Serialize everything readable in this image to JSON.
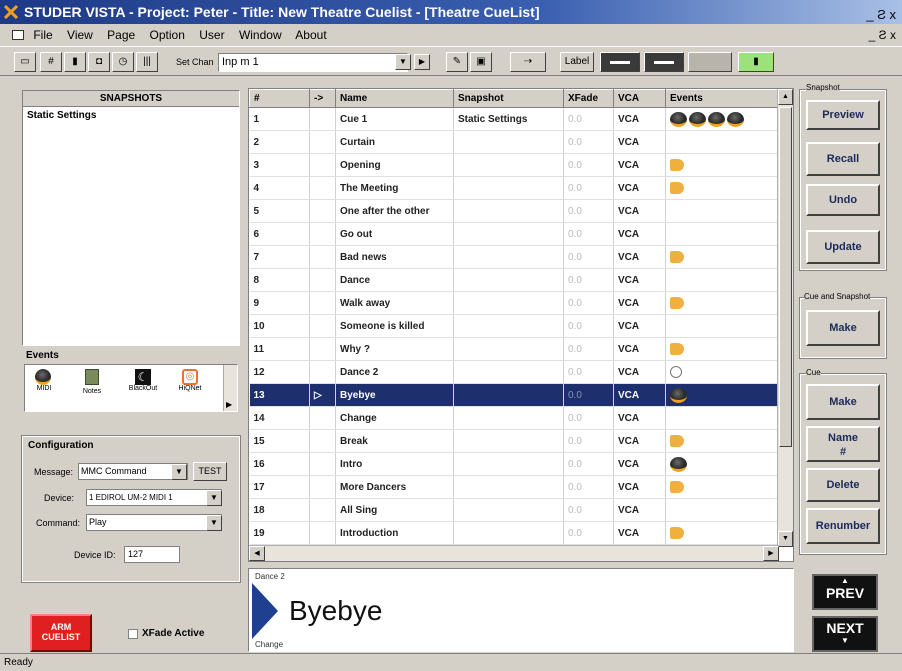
{
  "window": {
    "title": "STUDER VISTA - Project: Peter - Title: New Theatre Cuelist - [Theatre CueList]",
    "controls": "_ Ƨ x",
    "mdi_controls": "_ Ƨ x"
  },
  "menu": [
    "File",
    "View",
    "Page",
    "Option",
    "User",
    "Window",
    "About"
  ],
  "toolbar": {
    "set_chan_label": "Set Chan",
    "set_chan_value": "Inp m 1",
    "label_button": "Label",
    "status_colors": {
      "green": "#9be27a",
      "dark": "#3a3a3a"
    }
  },
  "snapshots": {
    "header": "SNAPSHOTS",
    "items": [
      "Static Settings"
    ]
  },
  "events_panel": {
    "header": "Events",
    "items": [
      {
        "label": "MIDI",
        "icon": "midi-icon"
      },
      {
        "label": "Notes",
        "icon": "notes-icon"
      },
      {
        "label": "BlackOut",
        "icon": "blackout-icon"
      },
      {
        "label": "HiQNet",
        "icon": "hiqnet-icon"
      }
    ]
  },
  "configuration": {
    "header": "Configuration",
    "message_label": "Message:",
    "message_value": "MMC Command",
    "test_button": "TEST",
    "device_label": "Device:",
    "device_value": "1 EDIROL UM-2 MIDI 1",
    "command_label": "Command:",
    "command_value": "Play",
    "device_id_label": "Device ID:",
    "device_id_value": "127"
  },
  "arm_cuelist": {
    "label": "ARM\nCUELIST",
    "color": "#e02020"
  },
  "xfade_active": {
    "label": "XFade Active",
    "checked": false
  },
  "cuelist": {
    "columns": [
      "#",
      "->",
      "Name",
      "Snapshot",
      "XFade",
      "VCA",
      "Events"
    ],
    "rows": [
      {
        "num": "1",
        "name": "Cue 1",
        "snapshot": "Static Settings",
        "xfade": "0.0",
        "vca": "VCA",
        "events": [
          "midi",
          "midi",
          "midi",
          "midi"
        ]
      },
      {
        "num": "2",
        "name": "Curtain",
        "snapshot": "",
        "xfade": "0.0",
        "vca": "VCA",
        "events": []
      },
      {
        "num": "3",
        "name": "Opening",
        "snapshot": "",
        "xfade": "0.0",
        "vca": "VCA",
        "events": [
          "horn"
        ]
      },
      {
        "num": "4",
        "name": "The Meeting",
        "snapshot": "",
        "xfade": "0.0",
        "vca": "VCA",
        "events": [
          "horn"
        ]
      },
      {
        "num": "5",
        "name": "One after the other",
        "snapshot": "",
        "xfade": "0.0",
        "vca": "VCA",
        "events": []
      },
      {
        "num": "6",
        "name": "Go out",
        "snapshot": "",
        "xfade": "0.0",
        "vca": "VCA",
        "events": []
      },
      {
        "num": "7",
        "name": "Bad news",
        "snapshot": "",
        "xfade": "0.0",
        "vca": "VCA",
        "events": [
          "horn"
        ]
      },
      {
        "num": "8",
        "name": "Dance",
        "snapshot": "",
        "xfade": "0.0",
        "vca": "VCA",
        "events": []
      },
      {
        "num": "9",
        "name": "Walk away",
        "snapshot": "",
        "xfade": "0.0",
        "vca": "VCA",
        "events": [
          "horn"
        ]
      },
      {
        "num": "10",
        "name": "Someone is killed",
        "snapshot": "",
        "xfade": "0.0",
        "vca": "VCA",
        "events": []
      },
      {
        "num": "11",
        "name": "Why ?",
        "snapshot": "",
        "xfade": "0.0",
        "vca": "VCA",
        "events": [
          "horn"
        ]
      },
      {
        "num": "12",
        "name": "Dance 2",
        "snapshot": "",
        "xfade": "0.0",
        "vca": "VCA",
        "events": [
          "timer"
        ]
      },
      {
        "num": "13",
        "name": "Byebye",
        "snapshot": "",
        "xfade": "0.0",
        "vca": "VCA",
        "events": [
          "midi"
        ],
        "selected": true
      },
      {
        "num": "14",
        "name": "Change",
        "snapshot": "",
        "xfade": "0.0",
        "vca": "VCA",
        "events": []
      },
      {
        "num": "15",
        "name": "Break",
        "snapshot": "",
        "xfade": "0.0",
        "vca": "VCA",
        "events": [
          "horn"
        ]
      },
      {
        "num": "16",
        "name": "Intro",
        "snapshot": "",
        "xfade": "0.0",
        "vca": "VCA",
        "events": [
          "midi"
        ]
      },
      {
        "num": "17",
        "name": "More Dancers",
        "snapshot": "",
        "xfade": "0.0",
        "vca": "VCA",
        "events": [
          "horn"
        ]
      },
      {
        "num": "18",
        "name": "All Sing",
        "snapshot": "",
        "xfade": "0.0",
        "vca": "VCA",
        "events": []
      },
      {
        "num": "19",
        "name": "Introduction",
        "snapshot": "",
        "xfade": "0.0",
        "vca": "VCA",
        "events": [
          "horn"
        ]
      }
    ]
  },
  "current_cue": {
    "previous": "Dance 2",
    "current": "Byebye",
    "next": "Change"
  },
  "right_panel": {
    "snapshot_group": "Snapshot",
    "preview": "Preview",
    "recall": "Recall",
    "undo": "Undo",
    "update": "Update",
    "cue_and_snapshot_group": "Cue and Snapshot",
    "make_cue_snapshot": "Make",
    "cue_group": "Cue",
    "make_cue": "Make",
    "name_number": "Name\n#",
    "delete": "Delete",
    "renumber": "Renumber",
    "prev": "PREV",
    "next": "NEXT"
  },
  "status": {
    "text": "Ready"
  }
}
